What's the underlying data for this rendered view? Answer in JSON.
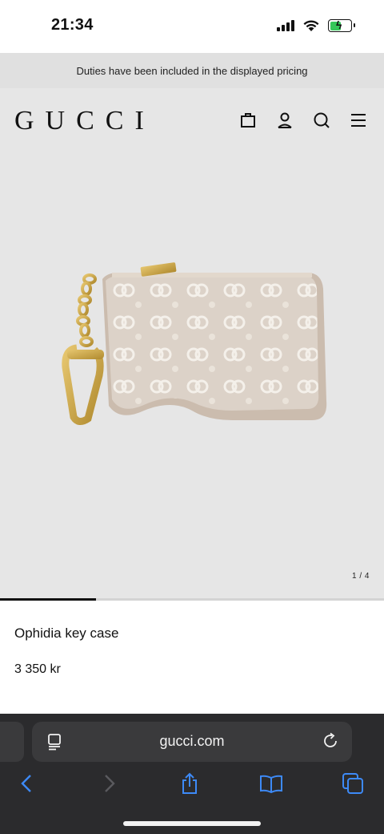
{
  "status_bar": {
    "time": "21:34"
  },
  "banner": {
    "text": "Duties have been included in the displayed pricing"
  },
  "header": {
    "logo": "GUCCI",
    "icons": [
      "shopping-bag-icon",
      "account-icon",
      "search-icon",
      "menu-icon"
    ]
  },
  "gallery": {
    "pager": "1 / 4",
    "progress": 0.25
  },
  "product": {
    "name": "Ophidia key case",
    "price": "3 350 kr"
  },
  "browser": {
    "url": "gucci.com",
    "toolbar": [
      "back-icon",
      "forward-icon",
      "share-icon",
      "bookmarks-icon",
      "tabs-icon"
    ]
  },
  "colors": {
    "header_bg": "#e6e6e6",
    "banner_bg": "#e0e0e0",
    "safari_bg": "#2b2b2d",
    "safari_accent": "#3d8af7"
  }
}
